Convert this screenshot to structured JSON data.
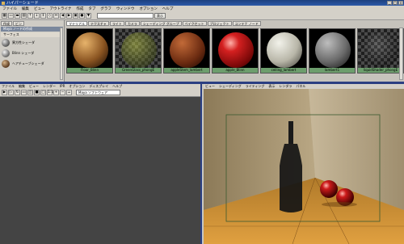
{
  "window": {
    "title": "ハイパーシェード"
  },
  "menubar": [
    "ファイル",
    "編集",
    "ビュー",
    "アウトライナ",
    "作成",
    "タブ",
    "グラフ",
    "ウィンドウ",
    "オプション",
    "ヘルプ"
  ],
  "toolbar": {
    "button_label": "表示"
  },
  "left_panel": {
    "tabs": [
      "作成",
      "ビン"
    ],
    "header": "Maya ノードの作成",
    "section": "サーフェス",
    "items": [
      "異方性シェーダ",
      "Blinn シェーダ",
      "ヘアチューブシェーダ"
    ]
  },
  "shelf": {
    "tabs": [
      "マテリアル",
      "テクスチャ",
      "ライト",
      "カメラ",
      "シェーディング グループ",
      "ベイクセット",
      "プロジェクト",
      "コンテナ ノード"
    ],
    "swatches": [
      {
        "label": "Floor_Blinn"
      },
      {
        "label": "GreenGlass_phongE"
      },
      {
        "label": "appleStem_lambert"
      },
      {
        "label": "apple_Blinn"
      },
      {
        "label": "ceiling_lambert"
      },
      {
        "label": "lambert1"
      },
      {
        "label": "liquidShader_phongE"
      }
    ]
  },
  "bottom_left": {
    "menu": [
      "ファイル",
      "編集",
      "ビュー",
      "レンダー",
      "IPR",
      "オプション",
      "ディスプレイ",
      "ヘルプ"
    ],
    "renderer": "Maya ソフトウェア"
  },
  "viewport": {
    "menu": [
      "ビュー",
      "シェーディング",
      "ライティング",
      "表示",
      "レンダラ",
      "パネル"
    ]
  },
  "colors": {
    "title_bar": "#1c3f7e",
    "divider": "#2b3f82",
    "swatch_label": "#6d9e6d"
  }
}
